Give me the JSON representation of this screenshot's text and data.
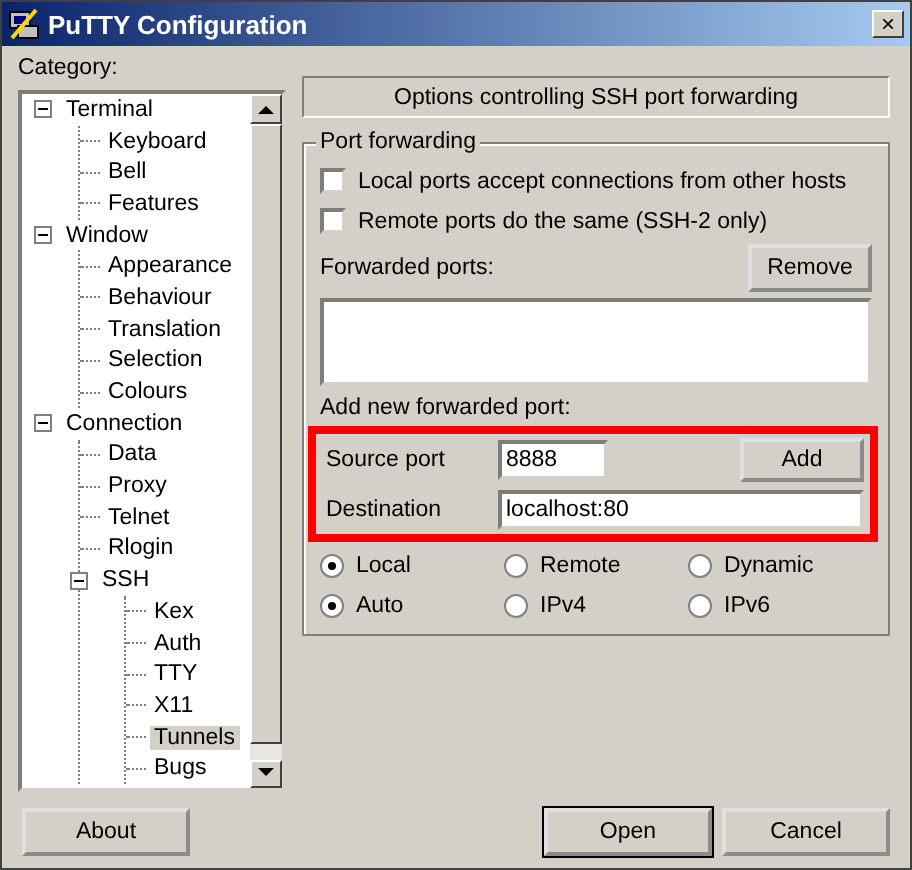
{
  "window": {
    "title": "PuTTY Configuration",
    "close": "×"
  },
  "category_label": "Category:",
  "tree": [
    {
      "label": "Terminal",
      "expanded": true,
      "selected": false,
      "children": [
        {
          "label": "Keyboard",
          "selected": false
        },
        {
          "label": "Bell",
          "selected": false
        },
        {
          "label": "Features",
          "selected": false
        }
      ]
    },
    {
      "label": "Window",
      "expanded": true,
      "selected": false,
      "children": [
        {
          "label": "Appearance",
          "selected": false
        },
        {
          "label": "Behaviour",
          "selected": false
        },
        {
          "label": "Translation",
          "selected": false
        },
        {
          "label": "Selection",
          "selected": false
        },
        {
          "label": "Colours",
          "selected": false
        }
      ]
    },
    {
      "label": "Connection",
      "expanded": true,
      "selected": false,
      "children": [
        {
          "label": "Data",
          "selected": false
        },
        {
          "label": "Proxy",
          "selected": false
        },
        {
          "label": "Telnet",
          "selected": false
        },
        {
          "label": "Rlogin",
          "selected": false
        },
        {
          "label": "SSH",
          "expanded": true,
          "selected": false,
          "children": [
            {
              "label": "Kex",
              "selected": false
            },
            {
              "label": "Auth",
              "selected": false
            },
            {
              "label": "TTY",
              "selected": false
            },
            {
              "label": "X11",
              "selected": false
            },
            {
              "label": "Tunnels",
              "selected": true
            },
            {
              "label": "Bugs",
              "selected": false
            }
          ]
        }
      ]
    }
  ],
  "panel_header": "Options controlling SSH port forwarding",
  "port_forwarding": {
    "title": "Port forwarding",
    "checkboxes": [
      {
        "label": "Local ports accept connections from other hosts",
        "checked": false
      },
      {
        "label": "Remote ports do the same (SSH-2 only)",
        "checked": false
      }
    ],
    "forwarded_label": "Forwarded ports:",
    "remove_button": "Remove",
    "add_label": "Add new forwarded port:",
    "source_label": "Source port",
    "source_value": "8888",
    "add_button": "Add",
    "destination_label": "Destination",
    "destination_value": "localhost:80",
    "direction": [
      {
        "label": "Local",
        "selected": true
      },
      {
        "label": "Remote",
        "selected": false
      },
      {
        "label": "Dynamic",
        "selected": false
      }
    ],
    "protocol": [
      {
        "label": "Auto",
        "selected": true
      },
      {
        "label": "IPv4",
        "selected": false
      },
      {
        "label": "IPv6",
        "selected": false
      }
    ]
  },
  "buttons": {
    "about": "About",
    "open": "Open",
    "cancel": "Cancel"
  }
}
